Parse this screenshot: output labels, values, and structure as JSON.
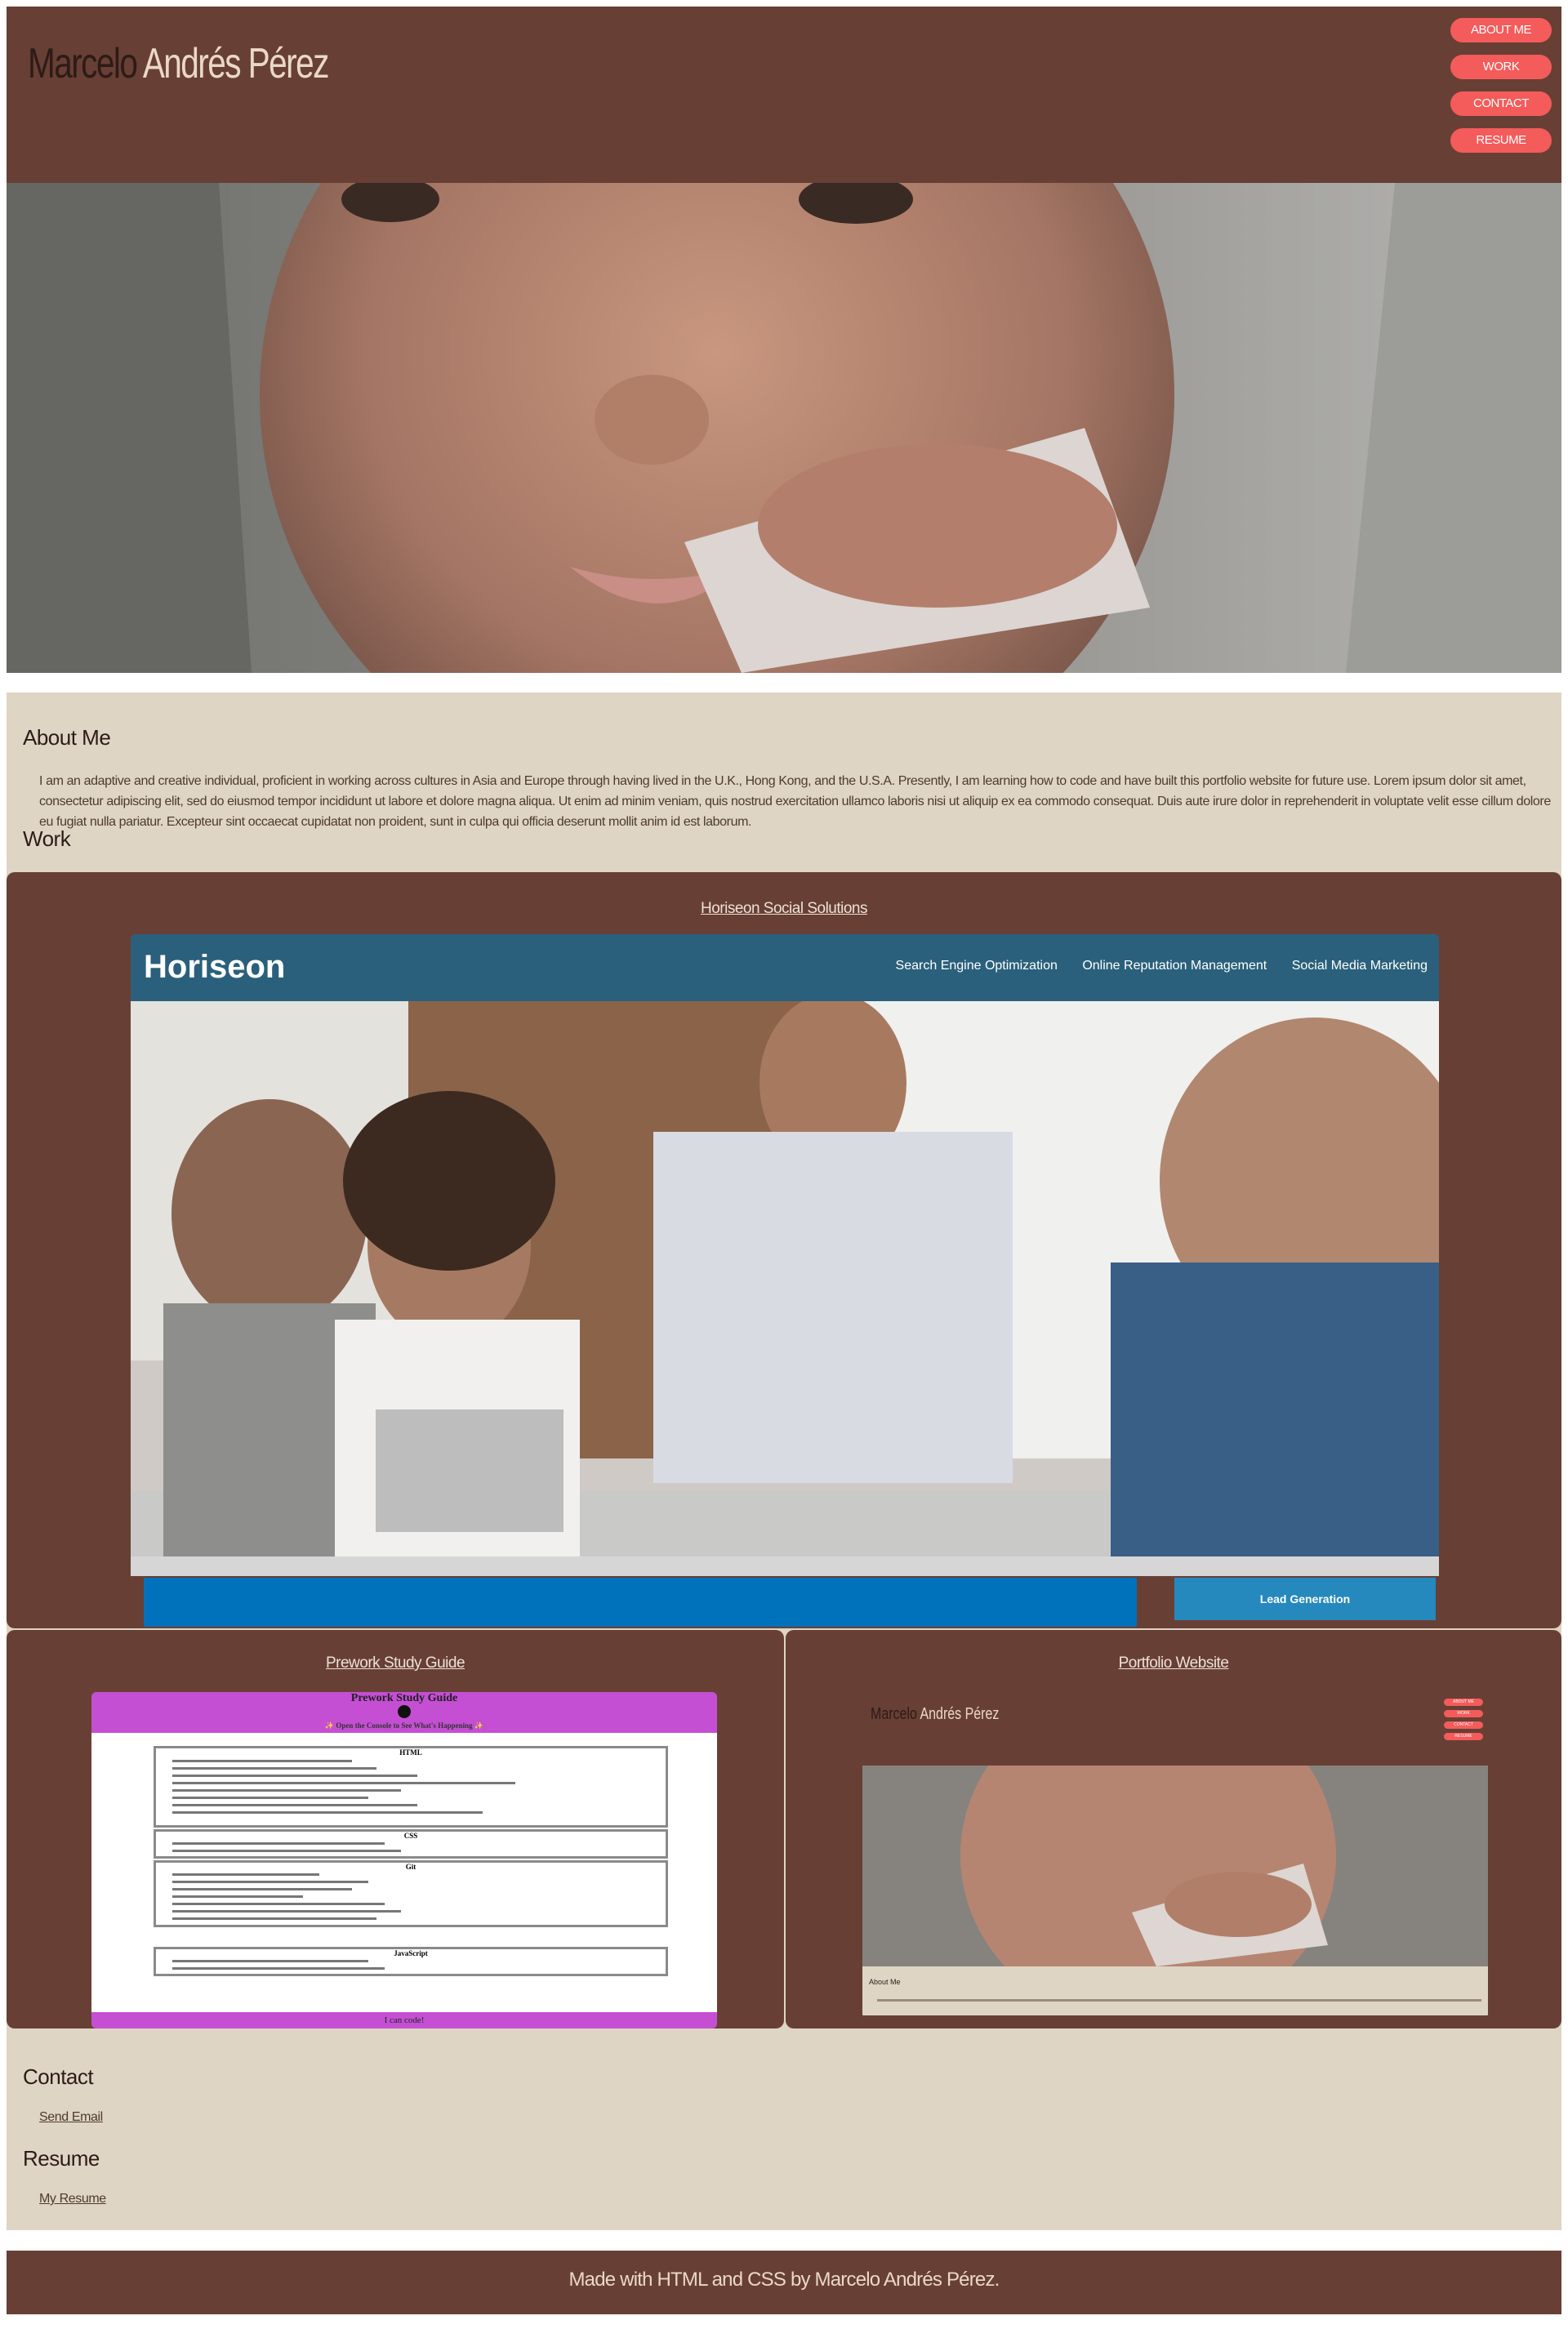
{
  "header": {
    "first_name": "Marcelo",
    "last_name": "Andrés Pérez",
    "nav": [
      "ABOUT ME",
      "WORK",
      "CONTACT",
      "RESUME"
    ]
  },
  "about": {
    "title": "About Me",
    "text": "I am an adaptive and creative individual, proficient in working across cultures in Asia and Europe through having lived in the U.K., Hong Kong, and the U.S.A. Presently, I am learning how to code and have built this portfolio website for future use. Lorem ipsum dolor sit amet, consectetur adipiscing elit, sed do eiusmod tempor incididunt ut labore et dolore magna aliqua. Ut enim ad minim veniam, quis nostrud exercitation ullamco laboris nisi ut aliquip ex ea commodo consequat. Duis aute irure dolor in reprehenderit in voluptate velit esse cillum dolore eu fugiat nulla pariatur. Excepteur sint occaecat cupidatat non proident, sunt in culpa qui officia deserunt mollit anim id est laborum."
  },
  "work": {
    "title": "Work",
    "projects": [
      {
        "title": "Horiseon Social Solutions",
        "screenshot": {
          "logo": "Horiseon",
          "nav": [
            "Search Engine Optimization",
            "Online Reputation Management",
            "Social Media Marketing"
          ],
          "cta": "Lead Generation"
        }
      },
      {
        "title": "Prework Study Guide",
        "screenshot": {
          "heading": "Prework Study Guide",
          "console_hint": "✨ Open the Console to See What's Happening ✨",
          "sections": [
            "HTML",
            "CSS",
            "Git",
            "JavaScript"
          ],
          "footer": "I can code!"
        }
      },
      {
        "title": "Portfolio Website",
        "screenshot": {
          "first_name": "Marcelo",
          "last_name": "Andrés Pérez",
          "about": "About Me"
        }
      }
    ]
  },
  "contact": {
    "title": "Contact",
    "link": "Send Email"
  },
  "resume": {
    "title": "Resume",
    "link": "My Resume"
  },
  "footer": {
    "text": "Made with HTML and CSS by Marcelo Andrés Pérez."
  },
  "colors": {
    "brown": "#683f35",
    "beige": "#ded5c5",
    "coral": "#f45b5b",
    "cream": "#ead8c7",
    "dark": "#2d1b17"
  }
}
